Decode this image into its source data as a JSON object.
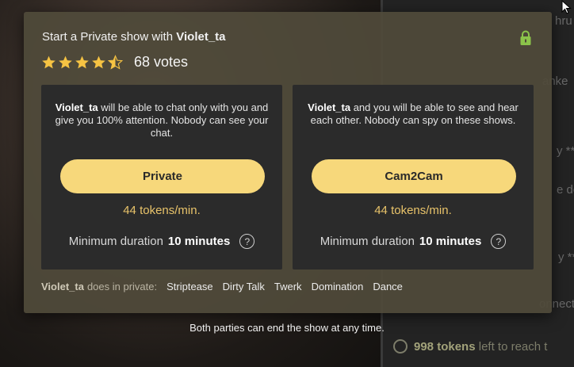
{
  "background": {
    "chat_lines": [
      "hru",
      "anke",
      "y **",
      "e do",
      "y **",
      "onnecte"
    ],
    "goal": {
      "tokens": "998",
      "tokens_word": "tokens",
      "text": "left to reach t"
    }
  },
  "modal": {
    "title_prefix": "Start a Private show with",
    "model_name": "Violet_ta",
    "rating": {
      "value": 4.5,
      "votes_label": "68 votes"
    },
    "colors": {
      "accent": "#f7d87b",
      "rate": "#e8c36a",
      "lock": "#8bc34a"
    },
    "cards": [
      {
        "name_bold": "Violet_ta",
        "desc_1": " will be able to chat only with you and give you 100% attention. Nobody can see your chat.",
        "button_label": "Private",
        "rate": "44 tokens/min.",
        "min_prefix": "Minimum duration",
        "min_value": "10 minutes"
      },
      {
        "name_bold": "Violet_ta",
        "desc_1": " and you will be able to see and hear each other. Nobody can spy on these shows.",
        "button_label": "Cam2Cam",
        "rate": "44 tokens/min.",
        "min_prefix": "Minimum duration",
        "min_value": "10 minutes"
      }
    ],
    "services": {
      "owner": "Violet_ta",
      "lead": "does in private:",
      "items": [
        "Striptease",
        "Dirty Talk",
        "Twerk",
        "Domination",
        "Dance"
      ]
    }
  },
  "footer_note": "Both parties can end the show at any time."
}
